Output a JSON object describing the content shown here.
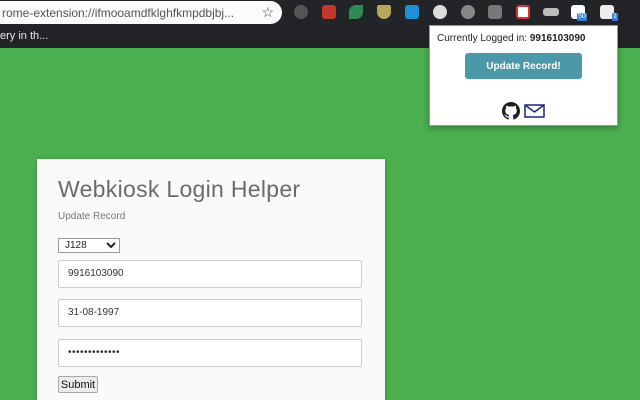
{
  "browser": {
    "url": "rome-extension://ifmooamdfklghfkmpdbjbj...",
    "bookmark": "ery in th...",
    "extension_badges": [
      "50",
      "1"
    ],
    "icons": [
      "star-icon",
      "ext-dark-circle-icon",
      "ext-red-book-icon",
      "ext-green-leaf-icon",
      "ext-shield-icon",
      "ext-blue-doc-icon",
      "ext-block-icon",
      "ext-gray-icon",
      "ext-wrench-icon",
      "ext-red-x-icon",
      "ext-battery-icon",
      "ext-p-icon",
      "ext-grid-icon"
    ]
  },
  "card": {
    "title": "Webkiosk Login Helper",
    "subtitle": "Update Record",
    "campus_options": [
      "J128"
    ],
    "campus_selected": "J128",
    "enrollment_value": "9916103090",
    "dob_value": "31-08-1997",
    "password_value": "•••••••••••••",
    "submit_label": "Submit"
  },
  "popup": {
    "logged_label": "Currently Logged in:",
    "logged_user": "9916103090",
    "update_label": "Update Record!",
    "icons": [
      "github-icon",
      "mail-icon"
    ]
  },
  "colors": {
    "background": "#4caf50",
    "chrome": "#222427",
    "accent_button": "#4a98a8",
    "card": "#fafafa"
  }
}
